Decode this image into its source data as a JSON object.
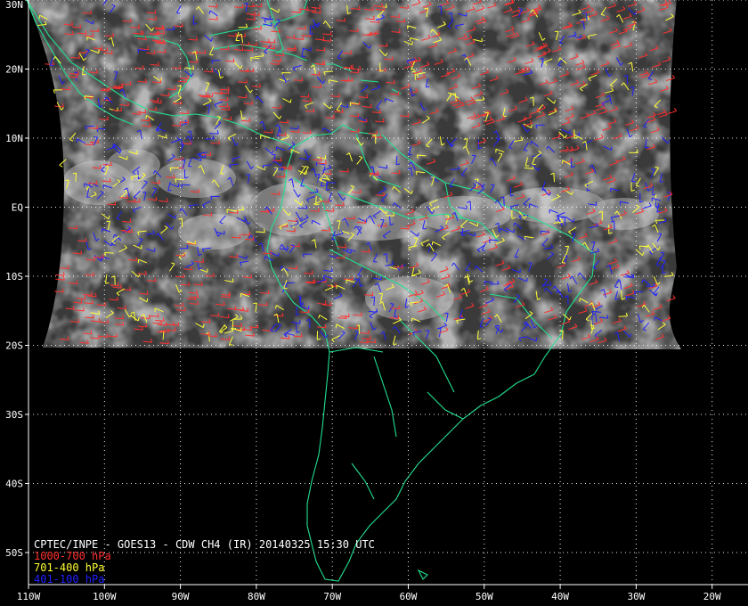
{
  "title": "CPTEC/INPE - GOES13 - CDW CH4 (IR) 20140325 15:30 UTC",
  "legend": [
    {
      "label": "1000-700 hPa",
      "color": "#ff3030"
    },
    {
      "label": "701-400 hPa",
      "color": "#ffff33"
    },
    {
      "label": "401-100 hPa",
      "color": "#2020ff"
    }
  ],
  "lat_labels": [
    "30N",
    "20N",
    "10N",
    "EQ",
    "10S",
    "20S",
    "30S",
    "40S",
    "50S"
  ],
  "lon_labels": [
    "110W",
    "100W",
    "90W",
    "80W",
    "70W",
    "60W",
    "50W",
    "40W",
    "30W",
    "20W"
  ],
  "colors": {
    "coast": "#22e090",
    "grid": "#ffffff",
    "cloud_dark": "#3a3a3a",
    "cloud_light": "#e8e8e8"
  }
}
